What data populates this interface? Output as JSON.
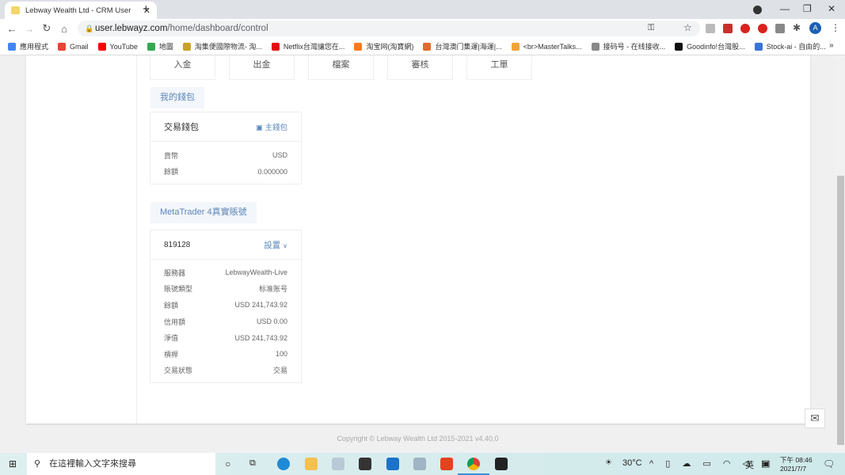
{
  "browser": {
    "tab_title": "Lebway Wealth Ltd - CRM User",
    "url_host": "user.lebwayz.com",
    "url_path": "/home/dashboard/control",
    "bookmarks": [
      {
        "label": "應用程式",
        "color": "#4285f4"
      },
      {
        "label": "Gmail",
        "color": "#ea4335"
      },
      {
        "label": "YouTube",
        "color": "#ff0000"
      },
      {
        "label": "地圖",
        "color": "#34a853"
      },
      {
        "label": "淘集便國際物流- 淘...",
        "color": "#c9a227"
      },
      {
        "label": "Netflix台灣讓您在...",
        "color": "#e50914"
      },
      {
        "label": "淘宝网(淘寶網)",
        "color": "#ff7a1a"
      },
      {
        "label": "台灣澳门集運|海運|...",
        "color": "#e06b2d"
      },
      {
        "label": "<br>MasterTalks...",
        "color": "#f2a33a"
      },
      {
        "label": "接码号 - 在线接收...",
        "color": "#888888"
      },
      {
        "label": "Goodinfo!台灣股...",
        "color": "#111111"
      },
      {
        "label": "Stock-ai - 自由的...",
        "color": "#3b73d6"
      }
    ],
    "more": "»",
    "avatar": "A"
  },
  "quick_actions": [
    "入金",
    "出金",
    "檔案",
    "審核",
    "工單"
  ],
  "wallet": {
    "section": "我的錢包",
    "title": "交易錢包",
    "link": "主錢包",
    "rows": [
      {
        "k": "貨幣",
        "v": "USD"
      },
      {
        "k": "餘額",
        "v": "0.000000"
      }
    ]
  },
  "mt4": {
    "section": "MetaTrader 4真實賬號",
    "account": "819128",
    "settings": "設置",
    "rows": [
      {
        "k": "服務器",
        "v": "LebwayWealth-Live"
      },
      {
        "k": "賬號類型",
        "v": "标准账号"
      },
      {
        "k": "餘額",
        "v": "USD 241,743.92"
      },
      {
        "k": "信用額",
        "v": "USD 0.00"
      },
      {
        "k": "淨值",
        "v": "USD 241,743.92"
      },
      {
        "k": "槓桿",
        "v": "100"
      },
      {
        "k": "交易狀態",
        "v": "交易"
      }
    ]
  },
  "footer": "Copyright © Lebway Wealth Ltd 2015-2021 v4.40.0",
  "taskbar": {
    "search_placeholder": "在這裡輸入文字來搜尋",
    "weather": "30°C",
    "ime": "英",
    "time": "下午 08:46",
    "date": "2021/7/7"
  }
}
